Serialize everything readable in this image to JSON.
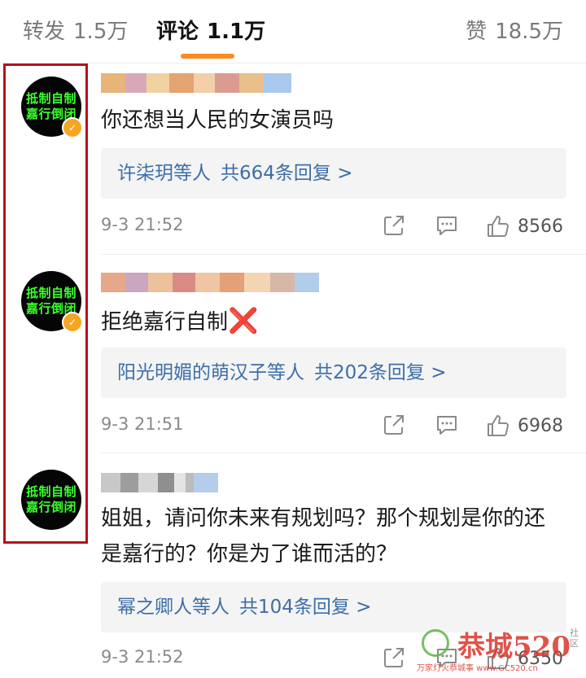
{
  "tabs": [
    {
      "label": "转发",
      "count": "1.5万"
    },
    {
      "label": "评论",
      "count": "1.1万"
    },
    {
      "label": "赞",
      "count": "18.5万"
    }
  ],
  "avatar_text": [
    "抵制自制",
    "嘉行倒闭"
  ],
  "comments": [
    {
      "text": "你还想当人民的女演员吗",
      "replies": {
        "who": "许柒玥等人",
        "total": "共664条回复 >"
      },
      "time": "9-3 21:52",
      "likes": "8566"
    },
    {
      "text": "拒绝嘉行自制",
      "emoji": "❌",
      "replies": {
        "who": "阳光明媚的萌汉子等人",
        "total": "共202条回复 >"
      },
      "time": "9-3 21:51",
      "likes": "6968"
    },
    {
      "text": "姐姐，请问你未来有规划吗？那个规划是你的还是嘉行的？你是为了谁而活的？",
      "replies": {
        "who": "幂之卿人等人",
        "total": "共104条回复 >"
      },
      "time": "9-3 21:52",
      "likes": "6350"
    }
  ],
  "watermark": {
    "main": "恭城520",
    "side": "社区",
    "sub": "万家灯火恭城事 www.GC520.cn"
  },
  "colors": {
    "accent": "#ff8a1e",
    "link": "#3d6ea8",
    "highlight_frame": "#b5121b",
    "avatar_text": "#3bff2b"
  },
  "icons": [
    "share-icon",
    "comment-icon",
    "thumbs-up-icon",
    "verified-badge-icon"
  ]
}
